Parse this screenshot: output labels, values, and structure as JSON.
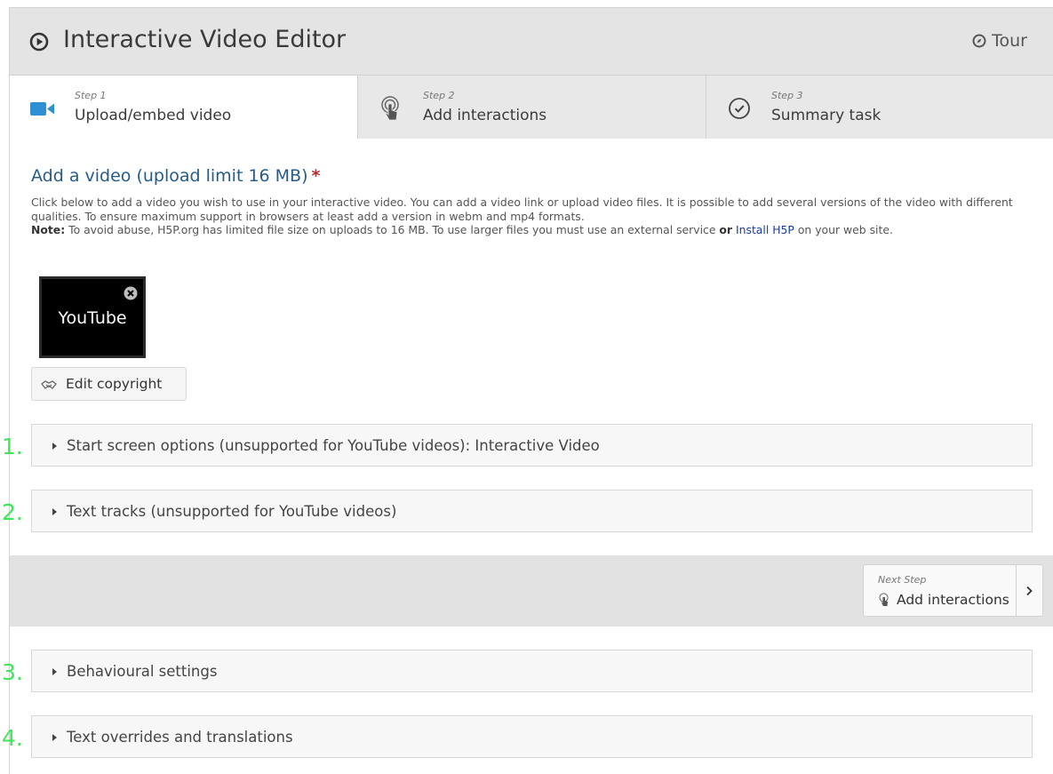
{
  "header": {
    "title": "Interactive Video Editor",
    "tour_label": "Tour"
  },
  "steps": [
    {
      "number": "Step 1",
      "label": "Upload/embed video",
      "icon": "video-camera-icon",
      "active": true
    },
    {
      "number": "Step 2",
      "label": "Add interactions",
      "icon": "touch-pointer-icon",
      "active": false
    },
    {
      "number": "Step 3",
      "label": "Summary task",
      "icon": "check-circle-icon",
      "active": false
    }
  ],
  "video_section": {
    "title": "Add a video (upload limit 16 MB)",
    "required_marker": "*",
    "description": "Click below to add a video you wish to use in your interactive video. You can add a video link or upload video files. It is possible to add several versions of the video with different qualities. To ensure maximum support in browsers at least add a version in webm and mp4 formats.",
    "note_label": "Note:",
    "note_text": " To avoid abuse, H5P.org has limited file size on uploads to 16 MB. To use larger files you must use an external service ",
    "note_or": "or",
    "note_link": "Install H5P",
    "note_end": " on your web site.",
    "thumbnail_label": "YouTube",
    "edit_copyright_label": "Edit copyright"
  },
  "collapsibles_top": [
    {
      "annotation": "1.",
      "label": "Start screen options (unsupported for YouTube videos): Interactive Video"
    },
    {
      "annotation": "2.",
      "label": "Text tracks (unsupported for YouTube videos)"
    }
  ],
  "next_step": {
    "small_label": "Next Step",
    "label": "Add interactions"
  },
  "collapsibles_bottom": [
    {
      "annotation": "3.",
      "label": "Behavioural settings"
    },
    {
      "annotation": "4.",
      "label": "Text overrides and translations"
    }
  ],
  "colors": {
    "title_blue": "#255b8a",
    "required_red": "#c0272d",
    "step1_icon_blue": "#2f8fd3",
    "annotation_green": "#3ee65a",
    "link_blue": "#1a3c9e"
  }
}
